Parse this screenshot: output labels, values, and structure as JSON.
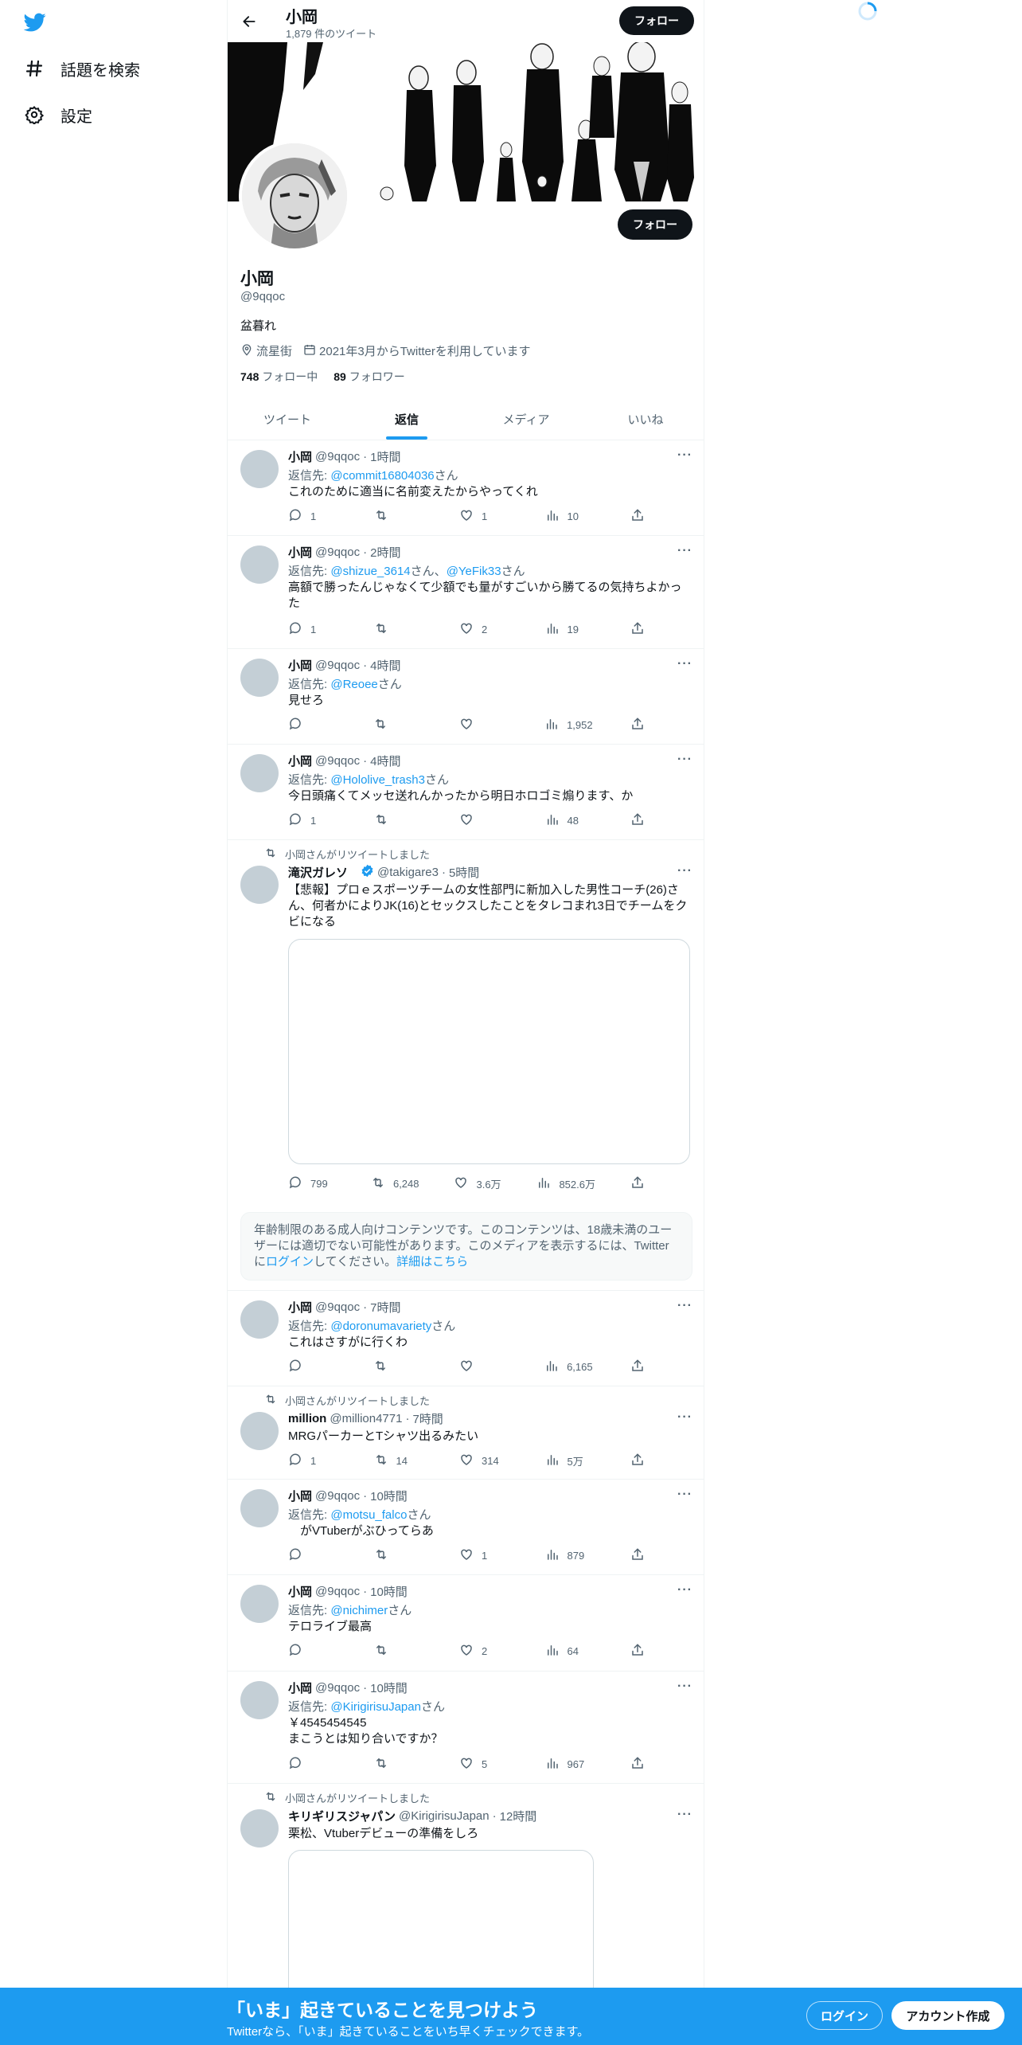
{
  "sidebar": {
    "logo": "twitter-bird-icon",
    "items": [
      {
        "label": "話題を検索",
        "icon": "hashtag-icon"
      },
      {
        "label": "設定",
        "icon": "gear-icon"
      }
    ]
  },
  "header": {
    "name": "小岡",
    "tweet_count": "1,879 件のツイート",
    "follow_label": "フォロー"
  },
  "profile": {
    "name": "小岡",
    "handle": "@9qqoc",
    "bio": "盆暮れ",
    "location": "流星街",
    "joined": "2021年3月からTwitterを利用しています",
    "following_count": "748",
    "following_label": "フォロー中",
    "followers_count": "89",
    "followers_label": "フォロワー",
    "follow_label": "フォロー"
  },
  "tabs": [
    {
      "label": "ツイート",
      "active": false
    },
    {
      "label": "返信",
      "active": true
    },
    {
      "label": "メディア",
      "active": false
    },
    {
      "label": "いいね",
      "active": false
    }
  ],
  "reply_prefix": "返信先:",
  "san": "さん",
  "sep": "と",
  "tweets": [
    {
      "name": "小岡",
      "handle": "@9qqoc",
      "time": "1時間",
      "reply_to": "@commit16804036",
      "text": "これのために適当に名前変えたからやってくれ",
      "replies": "1",
      "retweets": "",
      "likes": "1",
      "views": "10"
    },
    {
      "name": "小岡",
      "handle": "@9qqoc",
      "time": "2時間",
      "reply_to": "@shizue_3614",
      "reply_to2": "@YeFik33",
      "text": "高額で勝ったんじゃなくて少額でも量がすごいから勝てるの気持ちよかった",
      "replies": "1",
      "retweets": "",
      "likes": "2",
      "views": "19"
    },
    {
      "name": "小岡",
      "handle": "@9qqoc",
      "time": "4時間",
      "reply_to": "@Reoee",
      "text": "見せろ",
      "replies": "",
      "retweets": "",
      "likes": "",
      "views": "1,952"
    },
    {
      "name": "小岡",
      "handle": "@9qqoc",
      "time": "4時間",
      "reply_to": "@Hololive_trash3",
      "text": "今日頭痛くてメッセ送れんかったから明日ホロゴミ煽ります、か",
      "replies": "1",
      "retweets": "",
      "likes": "",
      "views": "48"
    },
    {
      "retweeted_by": "小岡さんがリツイートしました",
      "name": "滝沢ガレソ",
      "verified": true,
      "handle": "@takigare3",
      "time": "5時間",
      "text": "【悲報】プロｅスポーツチームの女性部門に新加入した男性コーチ(26)さん、何者かによりJK(16)とセックスしたことをタレコまれ3日でチームをクビになる",
      "replies": "799",
      "retweets": "6,248",
      "likes": "3.6万",
      "views": "852.6万"
    },
    {
      "name": "小岡",
      "handle": "@9qqoc",
      "time": "7時間",
      "reply_to": "@doronumavariety",
      "text": "これはさすがに行くわ",
      "replies": "",
      "retweets": "",
      "likes": "",
      "views": "6,165"
    },
    {
      "retweeted_by": "小岡さんがリツイートしました",
      "name": "million",
      "handle": "@million4771",
      "time": "7時間",
      "text": "MRGパーカーとTシャツ出るみたい",
      "replies": "1",
      "retweets": "14",
      "likes": "314",
      "views": "5万"
    },
    {
      "name": "小岡",
      "handle": "@9qqoc",
      "time": "10時間",
      "reply_to": "@motsu_falco",
      "text": "　がVTuberがぶひってらあ",
      "replies": "",
      "retweets": "",
      "likes": "1",
      "views": "879"
    },
    {
      "name": "小岡",
      "handle": "@9qqoc",
      "time": "10時間",
      "reply_to": "@nichimer",
      "text": "テロライブ最高",
      "replies": "",
      "retweets": "",
      "likes": "2",
      "views": "64"
    },
    {
      "name": "小岡",
      "handle": "@9qqoc",
      "time": "10時間",
      "reply_to": "@KirigirisuJapan",
      "text": "￥4545454545\nまこうとは知り合いですか？",
      "replies": "",
      "retweets": "",
      "likes": "5",
      "views": "967"
    },
    {
      "retweeted_by": "小岡さんがリツイートしました",
      "name": "キリギリスジャパン",
      "handle": "@KirigirisuJapan",
      "time": "12時間",
      "text": "栗松、Vtuberデビューの準備をしろ"
    }
  ],
  "nsfw_notice": {
    "text": "年齢制限のある成人向けコンテンツです。このコンテンツは、18歳未満のユーザーには適切でない可能性があります。このメディアを表示するには、Twitterに",
    "login_link": "ログイン",
    "mid": "してください。",
    "learn_more": "詳細はこちら"
  },
  "bottom_bar": {
    "title": "「いま」起きていることを見つけよう",
    "subtitle": "Twitterなら、「いま」起きていることをいち早くチェックできます。",
    "login_label": "ログイン",
    "signup_label": "アカウント作成"
  },
  "colors": {
    "accent": "#1d9bf0",
    "text": "#0f1419",
    "muted": "#536471",
    "verified": "#1d9bf0"
  }
}
